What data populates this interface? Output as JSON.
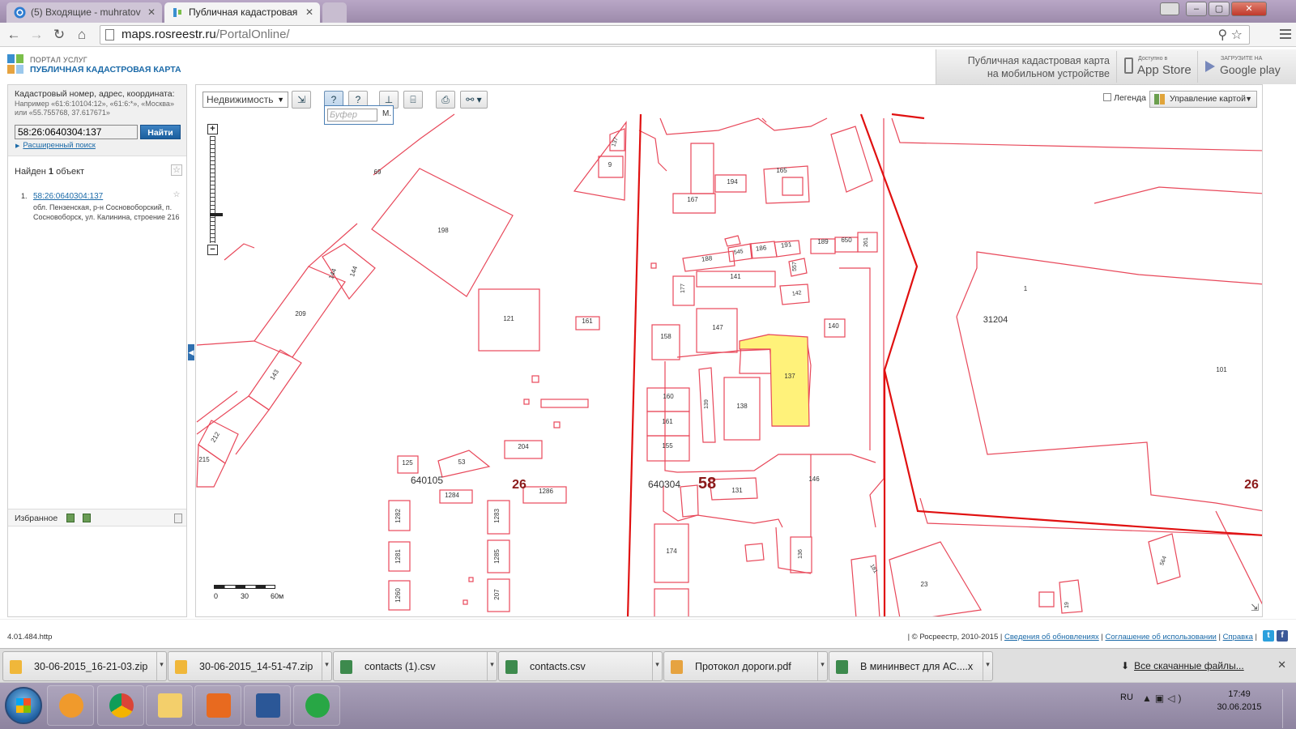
{
  "browser": {
    "tabs": [
      {
        "title": "(5) Входящие - muhratov"
      },
      {
        "title": "Публичная кадастровая"
      }
    ],
    "url_host": "maps.rosreestr.ru",
    "url_path": "/PortalOnline/",
    "window_buttons": {
      "minimize": "–",
      "maximize": "▢",
      "close": "✕"
    }
  },
  "header": {
    "logo_line1": "ПОРТАЛ УСЛУГ",
    "logo_line2": "ПУБЛИЧНАЯ КАДАСТРОВАЯ КАРТА",
    "promo_line1": "Публичная кадастровая карта",
    "promo_line2": "на мобильном устройстве",
    "appstore_small": "Доступно в",
    "appstore_large": "App Store",
    "googleplay_small": "ЗАГРУЗИТЕ НА",
    "googleplay_large": "Google play"
  },
  "search": {
    "label": "Кадастровый номер, адрес, координата:",
    "hint": "Например «61:6:10104:12», «61:6:*», «Москва» или «55.755768, 37.617671»",
    "value": "58:26:0640304:137",
    "button": "Найти",
    "advanced": "Расширенный поиск"
  },
  "results": {
    "found_prefix": "Найден",
    "found_count": "1",
    "found_suffix": "объект",
    "items": [
      {
        "num": "1.",
        "cadastral": "58:26:0640304:137",
        "address": "обл. Пензенская, р-н Сосновоборский, п. Сосновоборск, ул. Калинина, строение 216"
      }
    ]
  },
  "favorites": {
    "label": "Избранное"
  },
  "map_toolbar": {
    "layer_select": "Недвижимость",
    "buffer_placeholder": "Буфер",
    "buffer_unit": "М.",
    "legend_label": "Легенда",
    "map_management": "Управление картой"
  },
  "map": {
    "parcel_labels": [
      "69",
      "137",
      "9",
      "194",
      "165",
      "167",
      "198",
      "144",
      "144",
      "209",
      "143",
      "212",
      "215",
      "121",
      "161",
      "188",
      "545",
      "186",
      "191",
      "189",
      "650",
      "261",
      "557",
      "141",
      "177",
      "142",
      "147",
      "158",
      "140",
      "1",
      "31204",
      "101",
      "137",
      "160",
      "161",
      "155",
      "139",
      "138",
      "204",
      "125",
      "53",
      "640105",
      "26",
      "1284",
      "1286",
      "640304",
      "58",
      "131",
      "146",
      "26",
      "1282",
      "1281",
      "1260",
      "1283",
      "1285",
      "207",
      "174",
      "136",
      "181",
      "23",
      "19",
      "564"
    ],
    "highlight_color": "#fff27a",
    "parcel_color": "#e8485a",
    "boundary_color": "#e01010",
    "scale": {
      "zero": "0",
      "mid": "30",
      "end": "60м"
    }
  },
  "footer": {
    "version": "4.01.484.http",
    "copyright": "| © Росреестр, 2010-2015 |",
    "link_updates": "Сведения об обновлениях",
    "link_terms": "Соглашение об использовании",
    "link_help": "Справка",
    "sep": "|"
  },
  "downloads": {
    "items": [
      {
        "name": "30-06-2015_16-21-03.zip",
        "icon": "zip-icon",
        "color": "#f0b73a"
      },
      {
        "name": "30-06-2015_14-51-47.zip",
        "icon": "zip-icon",
        "color": "#f0b73a"
      },
      {
        "name": "contacts (1).csv",
        "icon": "excel-icon",
        "color": "#3d8a4d"
      },
      {
        "name": "contacts.csv",
        "icon": "excel-icon",
        "color": "#3d8a4d"
      },
      {
        "name": "Протокол дороги.pdf",
        "icon": "pdf-icon",
        "color": "#e6a340"
      },
      {
        "name": "В мининвест для АС....xl...",
        "icon": "excel-icon",
        "color": "#3d8a4d"
      }
    ],
    "show_all": "Все скачанные файлы...",
    "close": "✕"
  },
  "taskbar": {
    "lang": "RU",
    "time": "17:49",
    "date": "30.06.2015"
  }
}
